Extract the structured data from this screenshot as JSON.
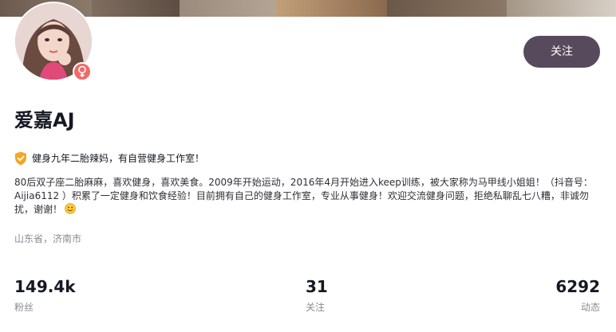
{
  "profile": {
    "nickname": "爱嘉AJ",
    "follow_label": "关注",
    "verification": "健身九年二胎辣妈，有自营健身工作室！",
    "bio": "80后双子座二胎麻麻，喜欢健身，喜欢美食。2009年开始运动，2016年4月开始进入keep训练，被大家称为马甲线小姐姐！（抖音号：Aijia6112 ）积累了一定健身和饮食经验！目前拥有自己的健身工作室，专业从事健身！欢迎交流健身问题，拒绝私聊乱七八糟，非诚勿扰，谢谢！",
    "location": "山东省，济南市",
    "gender_icon": "female-icon",
    "verified_icon": "shield-check-icon"
  },
  "stats": [
    {
      "value": "149.4k",
      "label": "粉丝"
    },
    {
      "value": "31",
      "label": "关注"
    },
    {
      "value": "6292",
      "label": "动态"
    }
  ],
  "colors": {
    "follow_button": "#574a5c",
    "gender_badge": "#f06a67",
    "verified_badge": "#f5a623",
    "muted_text": "#8a8b91"
  }
}
